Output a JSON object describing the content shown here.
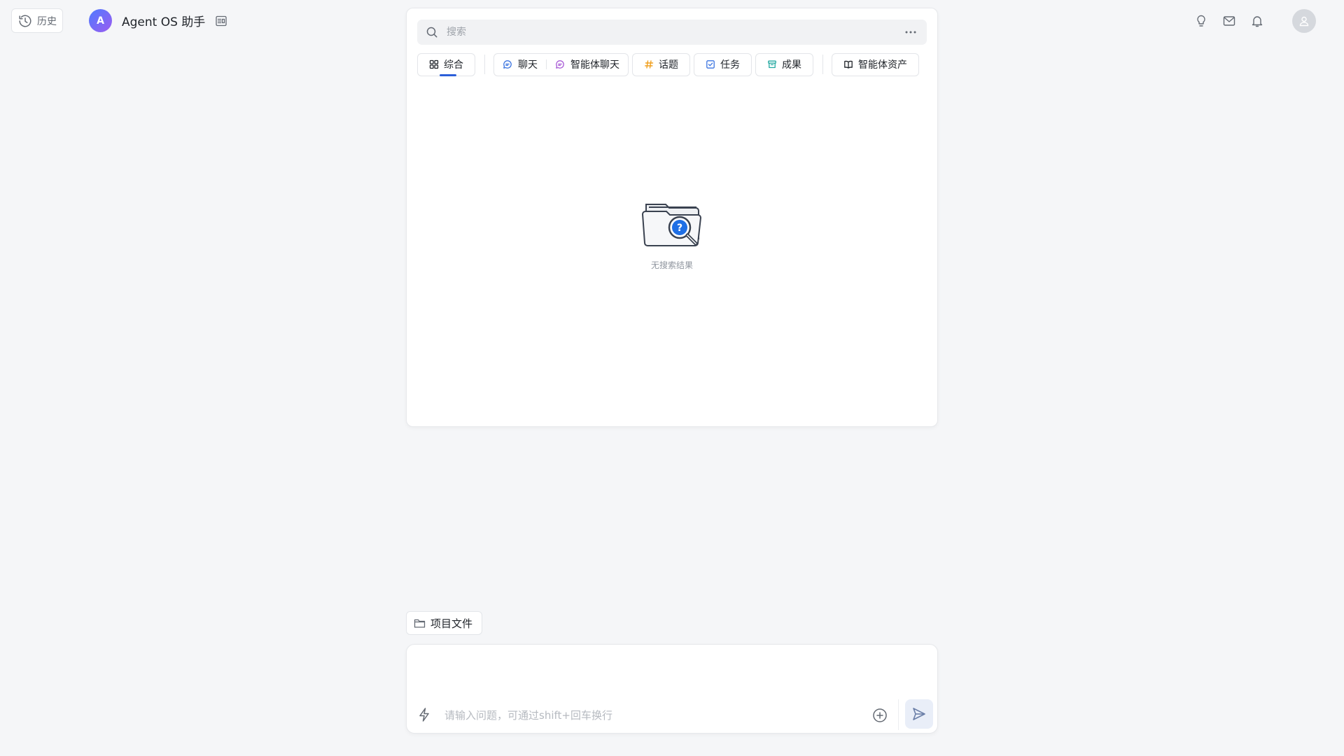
{
  "header": {
    "history_label": "历史",
    "agent_initial": "A",
    "agent_name": "Agent OS 助手",
    "icons": [
      "history-icon",
      "doc-card-icon",
      "lightbulb-icon",
      "mail-icon",
      "bell-icon",
      "user-avatar-icon"
    ]
  },
  "search": {
    "placeholder": "搜索",
    "more_icon": "more-horizontal-icon",
    "tabs": {
      "all": "综合",
      "chat": "聊天",
      "agent_chat": "智能体聊天",
      "topic": "话题",
      "task": "任务",
      "result": "成果",
      "agent_assets": "智能体资产"
    },
    "empty_text": "无搜索结果"
  },
  "composer": {
    "project_files_label": "项目文件",
    "input_placeholder": "请输入问题，可通过shift+回车换行"
  },
  "colors": {
    "accent": "#2b5fd9",
    "chat_icon": "#3b74e0",
    "agent_chat_icon": "#a85bd6",
    "topic_icon": "#f0a020",
    "task_icon": "#3b74e0",
    "result_icon": "#22a8a0",
    "background": "#f5f6f8"
  }
}
